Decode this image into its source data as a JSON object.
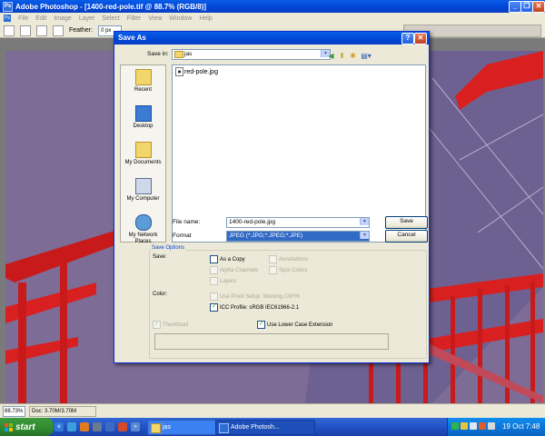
{
  "photoshop": {
    "title": "Adobe Photoshop - [1400-red-pole.tif @ 88.7% (RGB/8)]",
    "menu": [
      "File",
      "Edit",
      "Image",
      "Layer",
      "Select",
      "Filter",
      "View",
      "Window",
      "Help"
    ],
    "options": {
      "feather_label": "Feather:",
      "feather_value": "0 px"
    },
    "status": {
      "zoom": "88.73%",
      "doc": "Doc: 3.70M/3.70M"
    }
  },
  "dialog": {
    "title": "Save As",
    "help_button": "?",
    "close_button": "✕",
    "save_in_label": "Save in:",
    "save_in_value": "jas",
    "places": [
      "Recent",
      "Desktop",
      "My Documents",
      "My Computer",
      "My Network Places"
    ],
    "files": [
      "red-pole.jpg"
    ],
    "file_name_label": "File name:",
    "file_name_value": "1400-red-pole.jpg",
    "format_label": "Format",
    "format_value": "JPEG (*.JPG;*.JPEG;*.JPE)",
    "save_button": "Save",
    "cancel_button": "Cancel",
    "save_options": {
      "group_title": "Save Options",
      "save_label": "Save:",
      "as_a_copy": "As a Copy",
      "annotations": "Annotations",
      "alpha_channels": "Alpha Channels",
      "spot_colors": "Spot Colors",
      "layers": "Layers",
      "color_label": "Color:",
      "use_proof_setup": "Use Proof Setup:  Working CMYK",
      "icc_profile": "ICC Profile:  sRGB IEC61966-2.1",
      "thumbnail": "Thumbnail",
      "lower_case": "Use Lower Case Extension"
    }
  },
  "taskbar": {
    "start": "start",
    "buttons": [
      "jas",
      "Adobe Photosh..."
    ],
    "clock": "19 Oct  7:48"
  },
  "colors": {
    "xp_blue": "#0046d5",
    "dialog_bg": "#ece9d8",
    "selection": "#316ac5",
    "pole_red": "#d92020",
    "wall_purple": "#7c6b93"
  }
}
